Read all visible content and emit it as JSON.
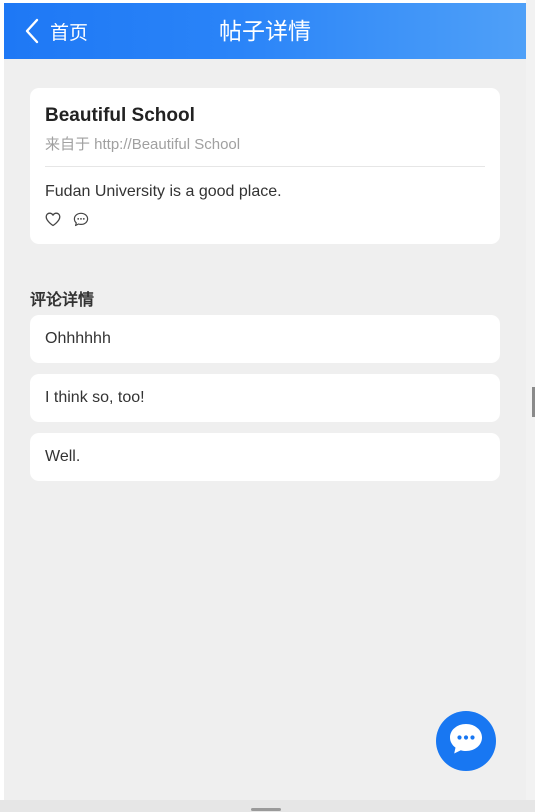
{
  "header": {
    "back_label": "首页",
    "title": "帖子详情"
  },
  "post": {
    "title": "Beautiful School",
    "source": "来自于 http://Beautiful School",
    "body": "Fudan University is a good place."
  },
  "comments": {
    "section_title": "评论详情",
    "items": [
      {
        "text": "Ohhhhhh"
      },
      {
        "text": "I think so, too!"
      },
      {
        "text": "Well."
      }
    ]
  },
  "colors": {
    "header_start": "#1e78f5",
    "header_end": "#4fa0f8",
    "background": "#efefef",
    "card": "#ffffff",
    "fab": "#1877f2"
  },
  "icons": {
    "back": "chevron-left-icon",
    "like": "heart-icon",
    "comment": "comment-bubble-icon",
    "fab": "chat-bubble-icon"
  }
}
